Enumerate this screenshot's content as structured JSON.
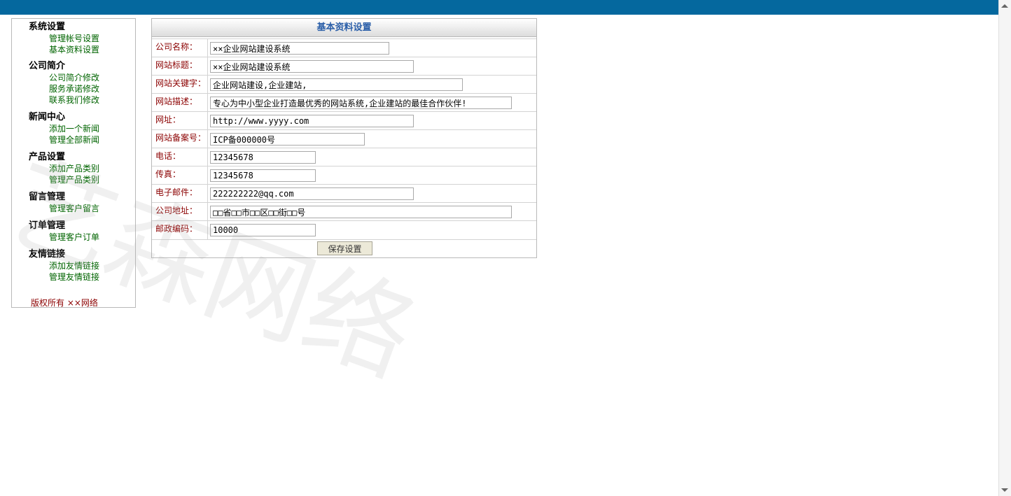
{
  "sidebar": {
    "groups": [
      {
        "title": "系统设置",
        "items": [
          "管理帐号设置",
          "基本资料设置"
        ]
      },
      {
        "title": "公司简介",
        "items": [
          "公司简介修改",
          "服务承诺修改",
          "联系我们修改"
        ]
      },
      {
        "title": "新闻中心",
        "items": [
          "添加一个新闻",
          "管理全部新闻"
        ]
      },
      {
        "title": "产品设置",
        "items": [
          "添加产品类别",
          "管理产品类别"
        ]
      },
      {
        "title": "留言管理",
        "items": [
          "管理客户留言"
        ]
      },
      {
        "title": "订单管理",
        "items": [
          "管理客户订单"
        ]
      },
      {
        "title": "友情链接",
        "items": [
          "添加友情链接",
          "管理友情链接"
        ]
      }
    ],
    "copyright": "版权所有 ××网络"
  },
  "form": {
    "title": "基本资料设置",
    "fields": [
      {
        "label": "公司名称：",
        "value": "××企业网站建设系统"
      },
      {
        "label": "网站标题：",
        "value": "××企业网站建设系统"
      },
      {
        "label": "网站关键字：",
        "value": "企业网站建设,企业建站,"
      },
      {
        "label": "网站描述：",
        "value": "专心为中小型企业打造最优秀的网站系统,企业建站的最佳合作伙伴!"
      },
      {
        "label": "网址：",
        "value": "http://www.yyyy.com"
      },
      {
        "label": "网站备案号：",
        "value": "ICP备000000号"
      },
      {
        "label": "电话：",
        "value": "12345678"
      },
      {
        "label": "传真：",
        "value": "12345678"
      },
      {
        "label": "电子邮件：",
        "value": "222222222@qq.com"
      },
      {
        "label": "公司地址：",
        "value": "□□省□□市□□区□□街□□号"
      },
      {
        "label": "邮政编码：",
        "value": "10000"
      }
    ],
    "save_label": "保存设置"
  },
  "watermark": "艺森网络",
  "colors": {
    "topbar": "#05689e",
    "label": "#8b0000",
    "link": "#006400",
    "header_title": "#2a5ea8"
  }
}
